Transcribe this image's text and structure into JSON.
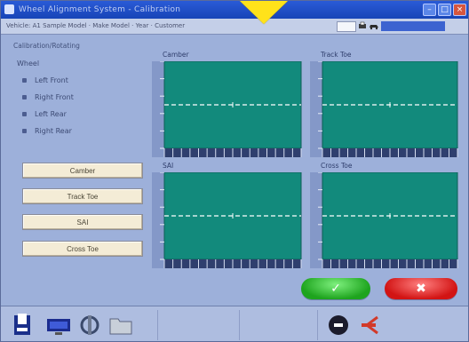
{
  "window": {
    "title": "Wheel Alignment System - Calibration"
  },
  "infobar": {
    "text": "Vehicle:  A1 Sample Model  ·  Make  Model  ·  Year  ·  Customer"
  },
  "section": {
    "title": "Calibration/Rotating"
  },
  "wheels": {
    "header": "Wheel",
    "items": [
      {
        "label": "Left Front"
      },
      {
        "label": "Right Front"
      },
      {
        "label": "Left Rear"
      },
      {
        "label": "Right Rear"
      }
    ]
  },
  "actions": [
    {
      "label": "Camber"
    },
    {
      "label": "Track Toe"
    },
    {
      "label": "SAI"
    },
    {
      "label": "Cross Toe"
    }
  ],
  "charts": [
    {
      "title": "Camber"
    },
    {
      "title": "Track Toe"
    },
    {
      "title": "SAI"
    },
    {
      "title": "Cross Toe"
    }
  ],
  "buttons": {
    "ok": "✓",
    "cancel": "✖"
  },
  "toolbar_icons": [
    "print-icon",
    "monitor-icon",
    "wrench-icon",
    "folder-icon",
    "stop-icon",
    "exit-icon"
  ],
  "colors": {
    "chart_bg": "#128a7c",
    "ok": "#2cc12c",
    "cancel": "#e11919",
    "marker": "#ffe21a"
  }
}
